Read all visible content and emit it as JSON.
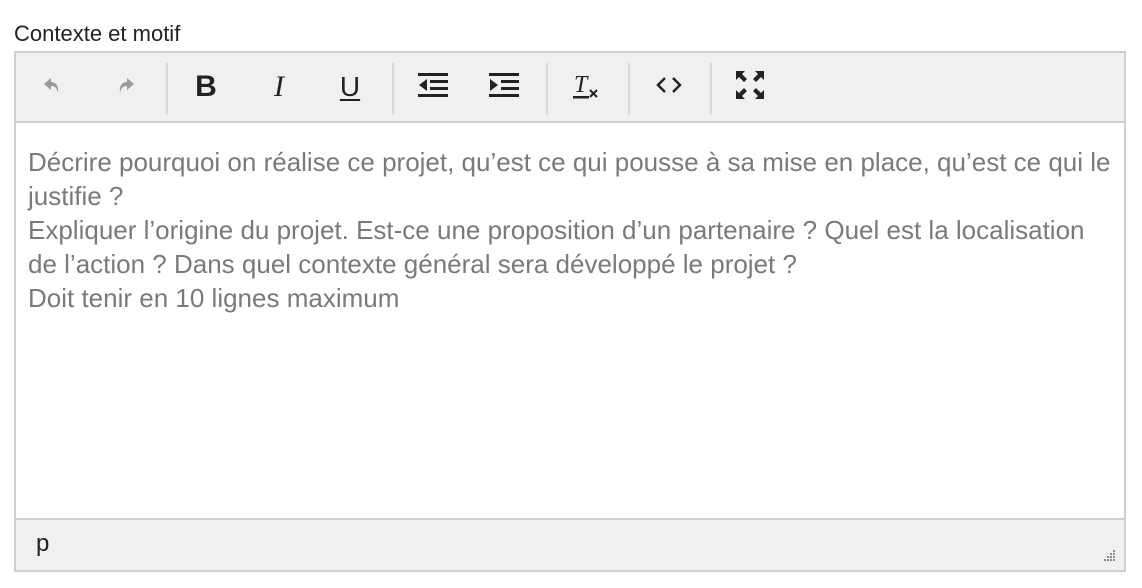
{
  "field": {
    "label": "Contexte et motif"
  },
  "toolbar": {
    "buttons": [
      {
        "name": "undo",
        "icon": "undo-icon",
        "enabled": false
      },
      {
        "name": "redo",
        "icon": "redo-icon",
        "enabled": false
      },
      {
        "name": "bold",
        "icon": "bold-icon",
        "glyph": "B"
      },
      {
        "name": "italic",
        "icon": "italic-icon",
        "glyph": "I"
      },
      {
        "name": "underline",
        "icon": "underline-icon",
        "glyph": "U"
      },
      {
        "name": "outdent",
        "icon": "outdent-icon"
      },
      {
        "name": "indent",
        "icon": "indent-icon"
      },
      {
        "name": "remove-format",
        "icon": "clear-formatting-icon"
      },
      {
        "name": "source-code",
        "icon": "code-icon"
      },
      {
        "name": "fullscreen",
        "icon": "fullscreen-icon"
      }
    ]
  },
  "content": {
    "placeholder_lines": [
      "Décrire pourquoi on réalise ce projet, qu’est ce qui pousse à sa mise en place, qu’est ce qui le justifie ?",
      "Expliquer l’origine du projet. Est-ce une proposition d’un partenaire ? Quel est la localisation de l’action ? Dans quel contexte général sera développé le projet ?",
      "Doit tenir en 10 lignes maximum"
    ]
  },
  "statusbar": {
    "path": "p"
  },
  "colors": {
    "toolbar_bg": "#f0f0f0",
    "border": "#cfcfcf",
    "placeholder_text": "#7a7a7a",
    "disabled_icon": "#9a9a9a"
  }
}
